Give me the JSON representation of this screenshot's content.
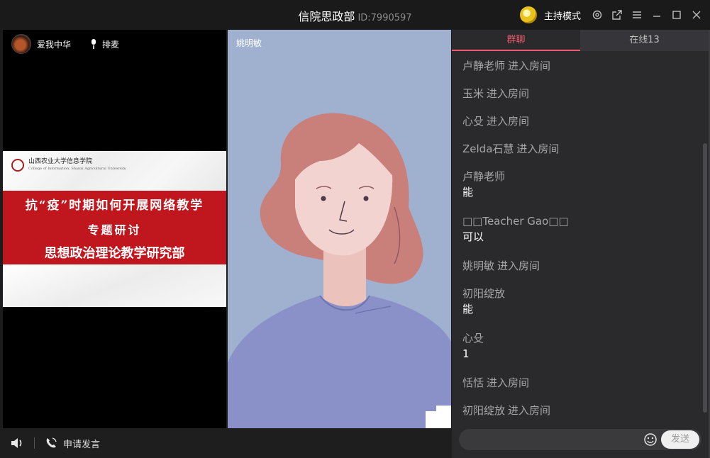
{
  "title_bar": {
    "title": "信院思政部",
    "room_id": "ID:7990597",
    "host_mode_label": "主持模式",
    "icons": [
      "gear-icon",
      "popout-icon",
      "menu-icon",
      "minimize-icon",
      "maximize-icon",
      "close-icon"
    ]
  },
  "video_left": {
    "username": "爱我中华",
    "mic_label": "排麦",
    "slide": {
      "school_name": "山西农业大学信息学院",
      "school_sub": "College of Information, Shanxi Agricultural University",
      "line1": "抗“疫”时期如何开展网络教学",
      "line2": "专题研讨",
      "line3": "思想政治理论教学研究部"
    }
  },
  "video_mid": {
    "username": "姚明敏"
  },
  "bottom_bar": {
    "apply_speak_label": "申请发言"
  },
  "panel": {
    "tabs": [
      {
        "label": "群聊",
        "active": true
      },
      {
        "label": "在线13",
        "active": false
      }
    ],
    "messages": [
      {
        "who": "卢静老师",
        "action": "进入房间"
      },
      {
        "who": "玉米",
        "action": "进入房间"
      },
      {
        "who": "心殳",
        "action": "进入房间"
      },
      {
        "who": "Zelda石慧",
        "action": "进入房间"
      },
      {
        "who": "卢静老师",
        "text": "能"
      },
      {
        "who": "□□Teacher Gao□□",
        "text": "可以"
      },
      {
        "who": "姚明敏",
        "action": "进入房间"
      },
      {
        "who": "初阳绽放",
        "text": "能"
      },
      {
        "who": "心殳",
        "text": "1"
      },
      {
        "who": "恬恬",
        "action": "进入房间"
      },
      {
        "who": "初阳绽放",
        "action": "进入房间"
      }
    ],
    "input_placeholder": "",
    "send_label": "发送"
  },
  "colors": {
    "accent": "#f05a6c",
    "slide_red": "#c0161d",
    "video_bg": "#9fb1cf",
    "sweater": "#8a90c8",
    "hair": "#c97f7a"
  }
}
